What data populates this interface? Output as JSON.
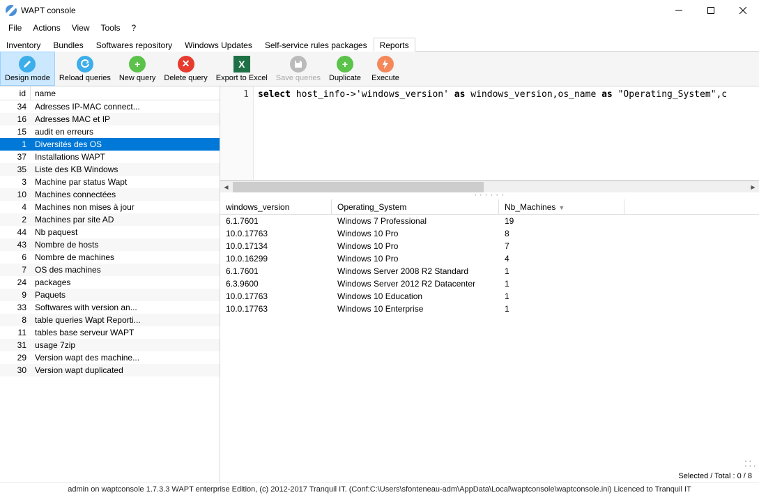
{
  "window": {
    "title": "WAPT console"
  },
  "menu": {
    "file": "File",
    "actions": "Actions",
    "view": "View",
    "tools": "Tools",
    "help": "?"
  },
  "tabs": {
    "items": [
      {
        "label": "Inventory",
        "active": false
      },
      {
        "label": "Bundles",
        "active": false
      },
      {
        "label": "Softwares repository",
        "active": false
      },
      {
        "label": "Windows Updates",
        "active": false
      },
      {
        "label": "Self-service rules packages",
        "active": false
      },
      {
        "label": "Reports",
        "active": true
      }
    ]
  },
  "toolbar": {
    "design": "Design mode",
    "reload": "Reload queries",
    "newq": "New query",
    "deleteq": "Delete query",
    "export": "Export to Excel",
    "save": "Save queries",
    "duplicate": "Duplicate",
    "execute": "Execute"
  },
  "queries": {
    "cols": {
      "id": "id",
      "name": "name"
    },
    "rows": [
      {
        "id": "34",
        "name": "Adresses IP-MAC connect...",
        "sel": false
      },
      {
        "id": "16",
        "name": "Adresses MAC et IP",
        "sel": false
      },
      {
        "id": "15",
        "name": "audit en erreurs",
        "sel": false
      },
      {
        "id": "1",
        "name": "Diversités des OS",
        "sel": true
      },
      {
        "id": "37",
        "name": "Installations WAPT",
        "sel": false
      },
      {
        "id": "35",
        "name": "Liste des KB Windows",
        "sel": false
      },
      {
        "id": "3",
        "name": "Machine par status Wapt",
        "sel": false
      },
      {
        "id": "10",
        "name": "Machines connectées",
        "sel": false
      },
      {
        "id": "4",
        "name": "Machines non mises à jour",
        "sel": false
      },
      {
        "id": "2",
        "name": "Machines par site AD",
        "sel": false
      },
      {
        "id": "44",
        "name": "Nb paquest",
        "sel": false
      },
      {
        "id": "43",
        "name": "Nombre de hosts",
        "sel": false
      },
      {
        "id": "6",
        "name": "Nombre de machines",
        "sel": false
      },
      {
        "id": "7",
        "name": "OS des machines",
        "sel": false
      },
      {
        "id": "24",
        "name": "packages",
        "sel": false
      },
      {
        "id": "9",
        "name": "Paquets",
        "sel": false
      },
      {
        "id": "33",
        "name": "Softwares with version an...",
        "sel": false
      },
      {
        "id": "8",
        "name": "table queries Wapt Reporti...",
        "sel": false
      },
      {
        "id": "11",
        "name": "tables base serveur WAPT",
        "sel": false
      },
      {
        "id": "31",
        "name": "usage 7zip",
        "sel": false
      },
      {
        "id": "29",
        "name": "Version wapt des machine...",
        "sel": false
      },
      {
        "id": "30",
        "name": "Version wapt duplicated",
        "sel": false
      }
    ]
  },
  "sql": {
    "lineno": "1",
    "kw_select": "select",
    "t1": " host_info->'windows_version' ",
    "kw_as1": "as",
    "t2": " windows_version,os_name ",
    "kw_as2": "as",
    "t3": " \"Operating_System\",c"
  },
  "results": {
    "cols": {
      "wv": "windows_version",
      "os": "Operating_System",
      "nb": "Nb_Machines"
    },
    "rows": [
      {
        "wv": "6.1.7601",
        "os": "Windows 7 Professional",
        "nb": "19"
      },
      {
        "wv": "10.0.17763",
        "os": "Windows 10 Pro",
        "nb": "8"
      },
      {
        "wv": "10.0.17134",
        "os": "Windows 10 Pro",
        "nb": "7"
      },
      {
        "wv": "10.0.16299",
        "os": "Windows 10 Pro",
        "nb": "4"
      },
      {
        "wv": "6.1.7601",
        "os": "Windows Server 2008 R2 Standard",
        "nb": "1"
      },
      {
        "wv": "6.3.9600",
        "os": "Windows Server 2012 R2 Datacenter",
        "nb": "1"
      },
      {
        "wv": "10.0.17763",
        "os": "Windows 10 Education",
        "nb": "1"
      },
      {
        "wv": "10.0.17763",
        "os": "Windows 10 Enterprise",
        "nb": "1"
      }
    ]
  },
  "selstatus": "Selected / Total : 0 / 8",
  "statusbar": "admin on waptconsole 1.7.3.3 WAPT enterprise Edition, (c) 2012-2017 Tranquil IT. (Conf:C:\\Users\\sfonteneau-adm\\AppData\\Local\\waptconsole\\waptconsole.ini) Licenced to Tranquil IT"
}
